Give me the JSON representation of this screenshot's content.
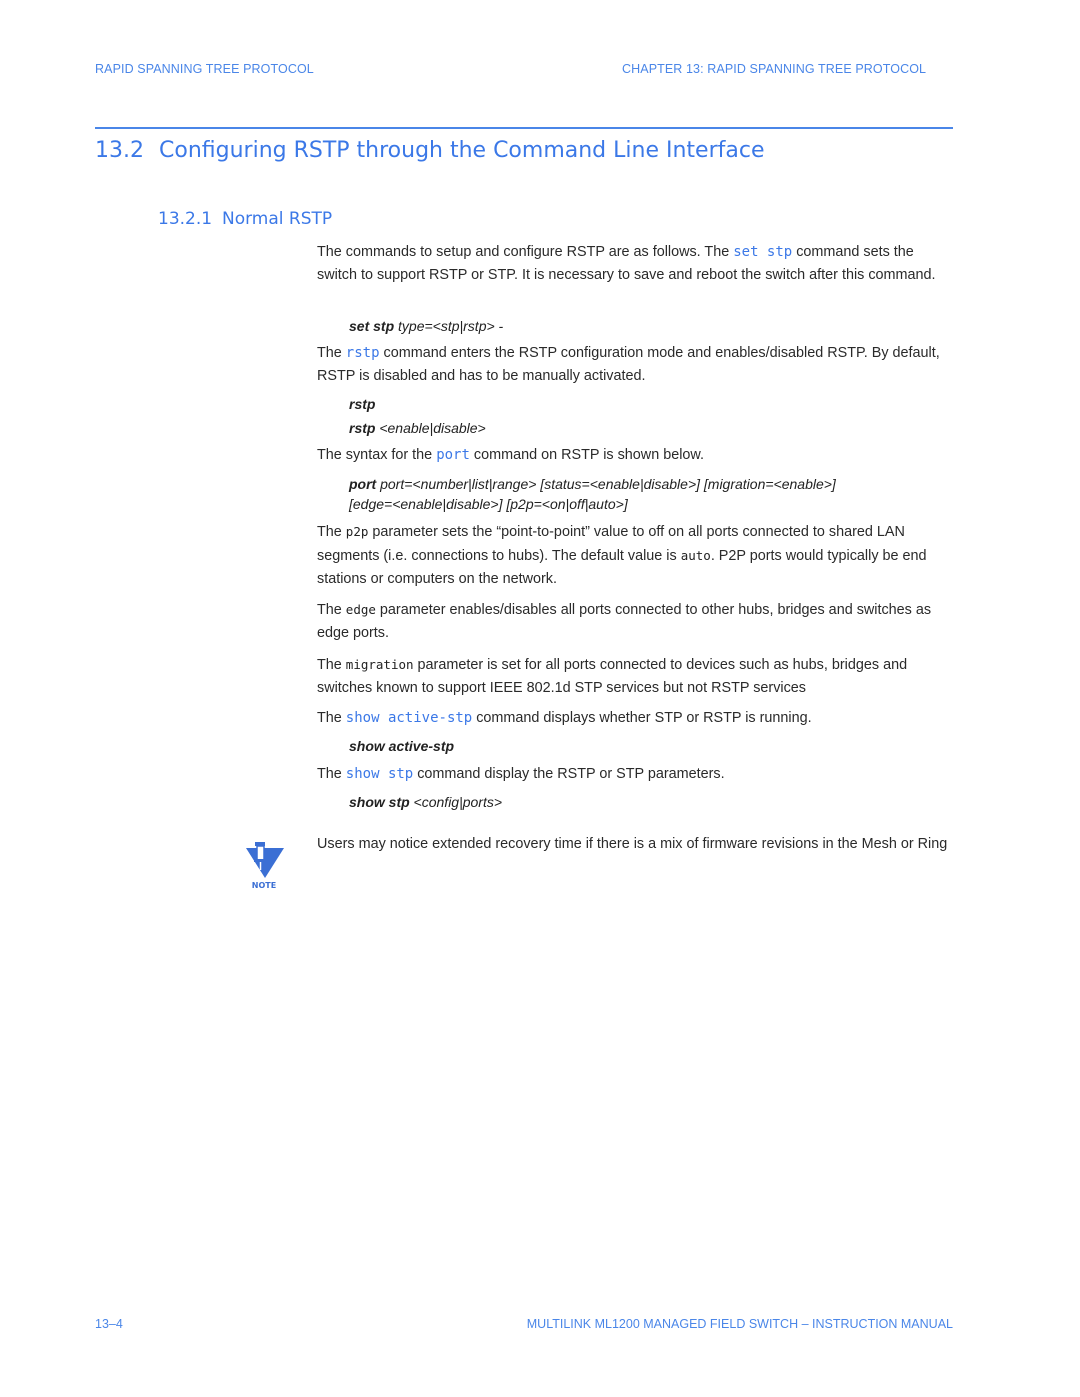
{
  "header": {
    "left": "RAPID SPANNING TREE PROTOCOL",
    "right": "CHAPTER 13: RAPID SPANNING TREE PROTOCOL"
  },
  "section": {
    "number": "13.2",
    "title": "Configuring RSTP through the Command Line Interface"
  },
  "subsection": {
    "number": "13.2.1",
    "title": "Normal RSTP"
  },
  "content": {
    "p1": {
      "pre": "The commands to setup and configure RSTP are as follows. The ",
      "code": "set stp",
      "post": " command sets the switch to support RSTP or STP. It is necessary to save and reboot the switch after this command."
    },
    "cmd1": {
      "bold": "set stp",
      "rest": " type=<stp|rstp> -"
    },
    "p2": {
      "pre": "The ",
      "code": "rstp",
      "post": " command enters the RSTP configuration mode and enables/disabled RSTP. By default, RSTP is disabled and has to be manually activated."
    },
    "cmd2a": {
      "bold": "rstp"
    },
    "cmd2b": {
      "bold": "rstp",
      "rest": " <enable|disable>"
    },
    "p3": {
      "pre": "The syntax for the ",
      "code": "port",
      "post": " command on RSTP is shown below."
    },
    "cmd3": {
      "bold": "port",
      "line1": " port=<number|list|range> [status=<enable|disable>] [migration=<enable>]",
      "line2": "[edge=<enable|disable>] [p2p=<on|off|auto>]"
    },
    "p4": {
      "pre": "The ",
      "code": "p2p",
      "mid": " parameter sets the “point-to-point” value to off on all ports connected to shared LAN segments (i.e. connections to hubs). The default value is ",
      "code2": "auto",
      "post": ". P2P ports would typically be end stations or computers on the network."
    },
    "p5": {
      "pre": "The ",
      "code": "edge",
      "post": " parameter enables/disables all ports connected to other hubs, bridges and switches as edge ports."
    },
    "p6": {
      "pre": "The ",
      "code": "migration",
      "post": " parameter is set for all ports connected to devices such as hubs, bridges and switches known to support IEEE 802.1d STP services but not RSTP services"
    },
    "p7": {
      "pre": "The ",
      "code": "show active-stp",
      "post": " command displays whether STP or RSTP is running."
    },
    "cmd4": {
      "bold": "show active-stp"
    },
    "p8": {
      "pre": "The ",
      "code": "show stp",
      "post": " command display the RSTP or STP parameters."
    },
    "cmd5": {
      "bold": "show stp",
      "rest": " <config|ports>"
    }
  },
  "note": {
    "icon": "note-pushpin-icon",
    "label": "NOTE",
    "text": "Users may notice extended recovery time if there is a mix of firmware revisions in the Mesh or Ring"
  },
  "footer": {
    "page": "13–4",
    "manual": "MULTILINK ML1200 MANAGED FIELD SWITCH – INSTRUCTION MANUAL"
  },
  "colors": {
    "accent": "#3b78e7",
    "text": "#2a2a2a"
  }
}
